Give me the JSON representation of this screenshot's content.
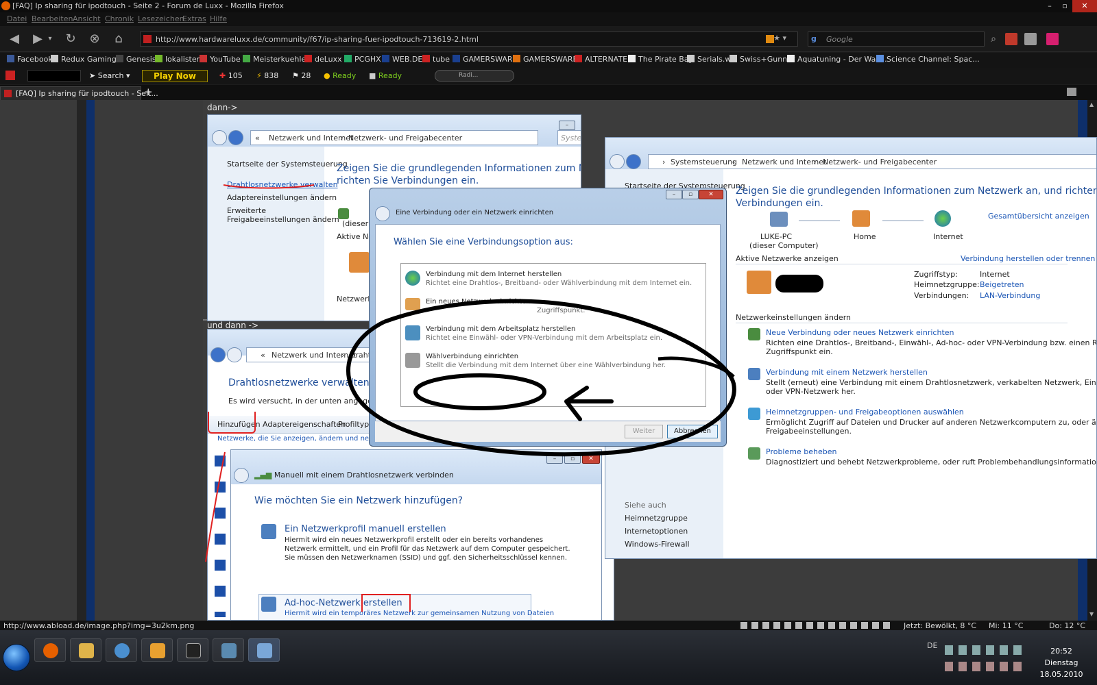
{
  "browser": {
    "title": "[FAQ] Ip sharing für ipodtouch - Seite 2 - Forum de Luxx - Mozilla Firefox",
    "menu": [
      "Datei",
      "Bearbeiten",
      "Ansicht",
      "Chronik",
      "Lesezeichen",
      "Extras",
      "Hilfe"
    ],
    "url": "http://www.hardwareluxx.de/community/f67/ip-sharing-fuer-ipodtouch-713619-2.html",
    "search_placeholder": "Google",
    "bookmarks": [
      "Facebook",
      "Redux Gaming™",
      "Genesis",
      "lokalisten",
      "YouTube",
      "Meisterkuehler",
      "deLuxx",
      "PCGHX",
      "WEB.DE",
      "tube",
      "GAMERSWARE",
      "GAMERSWARE",
      "ALTERNATE",
      "The Pirate Bay",
      "Serials.ws",
      "Swiss+Gunner",
      "Aquatuning - Der Was...",
      "Science Channel: Spac..."
    ],
    "toolbar": {
      "search_label": "Search",
      "play_now": "Play Now",
      "stat_health": "105",
      "stat_energy": "838",
      "stat_stamina": "28",
      "ready1": "Ready",
      "ready2": "Ready",
      "radio": "Radi..."
    },
    "tab_title": "[FAQ] Ip sharing für ipodtouch - Seit...",
    "new_tab": "+",
    "status_url": "http://www.abload.de/image.php?img=3u2km.png"
  },
  "forum": {
    "text1": "dann->",
    "text2": "und dann ->"
  },
  "win_a": {
    "path": [
      "«",
      "Netzwerk und Internet",
      "›",
      "Netzwerk- und Freigabecenter"
    ],
    "search_placeholder": "System",
    "sidebar": [
      "Startseite der Systemsteuerung",
      "Drahtlosnetzwerke verwalten",
      "Adaptereinstellungen ändern",
      "Erweiterte",
      "Freigabeeinstellungen ändern"
    ],
    "heading": "Zeigen Sie die grundlegenden Informationen zum Netzwerk a",
    "heading2": "richten Sie Verbindungen ein.",
    "frag1": "(dieser C",
    "frag2": "Aktive Net",
    "frag3": "Netzwerke"
  },
  "win_b": {
    "path": [
      "«",
      "Netzwerk und Internet",
      "›",
      "Draht"
    ],
    "heading": "Drahtlosnetzwerke verwalten, die",
    "subtext": "Es wird versucht, in der unten angegebenen Re",
    "toolbar": [
      "Hinzufügen",
      "Adaptereigenschaften",
      "Profiltype"
    ],
    "hint": "Netzwerke, die Sie anzeigen, ändern und neu anord"
  },
  "win_c": {
    "title": "Manuell mit einem Drahtlosnetzwerk verbinden",
    "heading": "Wie möchten Sie ein Netzwerk hinzufügen?",
    "opt1_title": "Ein Netzwerkprofil manuell erstellen",
    "opt1_desc": [
      "Hiermit wird ein neues Netzwerkprofil erstellt oder ein bereits vorhandenes",
      "Netzwerk ermittelt, und ein Profil für das Netzwerk auf dem Computer gespeichert.",
      "Sie müssen den Netzwerknamen (SSID) und ggf. den Sicherheitsschlüssel kennen."
    ],
    "opt2_title": "Ad-hoc-Netzwerk erstellen",
    "opt2_desc": "Hiermit wird ein temporäres Netzwerk zur gemeinsamen Nutzung von Dateien"
  },
  "win_d": {
    "path": [
      "›",
      "Systemsteuerung",
      "›",
      "Netzwerk und Internet",
      "›",
      "Netzwerk- und Freigabecenter"
    ],
    "sidebar_home": "Startseite der Systemsteuerung",
    "heading": "Zeigen Sie die grundlegenden Informationen zum Netzwerk an, und richten Sie",
    "heading2": "Verbindungen ein.",
    "overview_link": "Gesamtübersicht anzeigen",
    "map": [
      "LUKE-PC",
      "(dieser Computer)",
      "Home",
      "Internet"
    ],
    "active_label": "Aktive Netzwerke anzeigen",
    "connect_link": "Verbindung herstellen oder trennen",
    "props": [
      {
        "k": "Zugriffstyp:",
        "v": "Internet"
      },
      {
        "k": "Heimnetzgruppe:",
        "v": "Beigetreten"
      },
      {
        "k": "Verbindungen:",
        "v": "LAN-Verbindung"
      }
    ],
    "change_label": "Netzwerkeinstellungen ändern",
    "tasks": [
      {
        "title": "Neue Verbindung oder neues Netzwerk einrichten",
        "desc": [
          "Richten eine Drahtlos-, Breitband-, Einwähl-, Ad-hoc- oder VPN-Verbindung bzw. einen Router oder",
          "Zugriffspunkt ein."
        ]
      },
      {
        "title": "Verbindung mit einem Netzwerk herstellen",
        "desc": [
          "Stellt (erneut) eine Verbindung mit einem Drahtlosnetzwerk, verkabelten Netzwerk, Einwählnetzwerk",
          "oder VPN-Netzwerk her."
        ]
      },
      {
        "title": "Heimnetzgruppen- und Freigabeoptionen auswählen",
        "desc": [
          "Ermöglicht Zugriff auf Dateien und Drucker auf anderen Netzwerkcomputern zu, oder ändert die",
          "Freigabeeinstellungen."
        ]
      },
      {
        "title": "Probleme beheben",
        "desc": [
          "Diagnostiziert und behebt Netzwerkprobleme, oder ruft Problembehandlungsinformationen ab."
        ]
      }
    ],
    "see_also": "Siehe auch",
    "see_also_links": [
      "Heimnetzgruppe",
      "Internetoptionen",
      "Windows-Firewall"
    ]
  },
  "dialog": {
    "title": "Eine Verbindung oder ein Netzwerk einrichten",
    "heading": "Wählen Sie eine Verbindungsoption aus:",
    "options": [
      {
        "title": "Verbindung mit dem Internet herstellen",
        "desc": "Richtet eine Drahtlos-, Breitband- oder Wählverbindung mit dem Internet ein."
      },
      {
        "title": "Ein neues Netzwerk einrichten",
        "desc": "Zugriffspunkt."
      },
      {
        "title": "Verbindung mit dem Arbeitsplatz herstellen",
        "desc": "Richtet eine Einwähl- oder VPN-Verbindung mit dem Arbeitsplatz ein."
      },
      {
        "title": "Wählverbindung einrichten",
        "desc": "Stellt die Verbindung mit dem Internet über eine Wählverbindung her."
      }
    ],
    "next": "Weiter",
    "cancel": "Abbrechen"
  },
  "statusbar": {
    "weather_now": "Jetzt: Bewölkt, 8 °C",
    "weather_wed": "Mi: 11 °C",
    "weather_thu": "Do: 12 °C"
  },
  "taskbar": {
    "lang": "DE",
    "time": "20:52",
    "day": "Dienstag",
    "date": "18.05.2010"
  }
}
